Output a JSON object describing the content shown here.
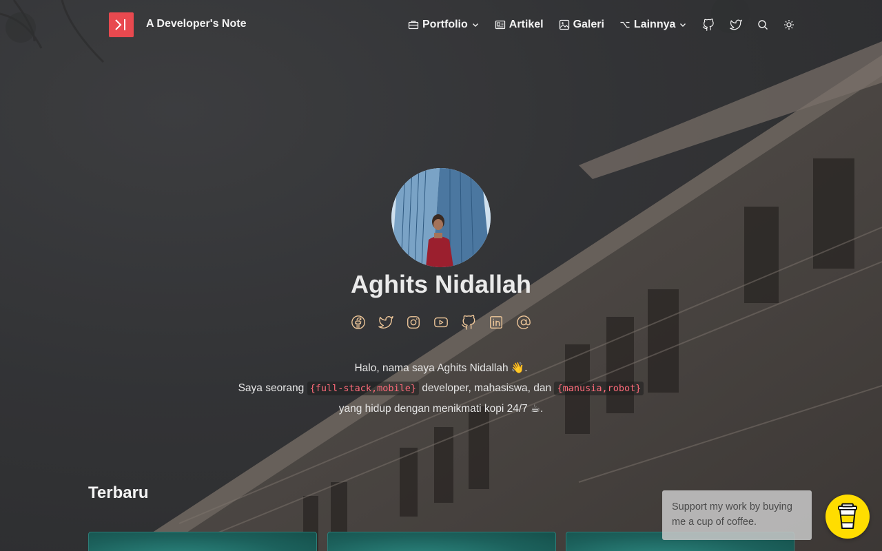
{
  "header": {
    "site_title": "A Developer's Note",
    "nav": [
      {
        "label": "Portfolio",
        "icon": "briefcase-icon",
        "dropdown": true
      },
      {
        "label": "Artikel",
        "icon": "newspaper-icon",
        "dropdown": false
      },
      {
        "label": "Galeri",
        "icon": "image-icon",
        "dropdown": false
      },
      {
        "label": "Lainnya",
        "icon": "option-key-icon",
        "dropdown": true
      }
    ],
    "icon_buttons": [
      "github-icon",
      "twitter-icon",
      "search-icon",
      "sun-icon"
    ]
  },
  "hero": {
    "name": "Aghits Nidallah",
    "socials": [
      "facebook-icon",
      "twitter-icon",
      "instagram-icon",
      "youtube-icon",
      "github-icon",
      "linkedin-icon",
      "at-sign-icon"
    ],
    "bio": {
      "line1": "Halo, nama saya Aghits Nidallah 👋.",
      "line2_a": "Saya seorang",
      "line2_code1": "{full-stack,mobile}",
      "line2_b": "developer, mahasiswa, dan",
      "line2_code2": "{manusia,robot}",
      "line3": "yang hidup dengan menikmati kopi 24/7 ☕."
    }
  },
  "latest": {
    "title": "Terbaru"
  },
  "support": {
    "text": "Support my work by buying me a cup of coffee."
  },
  "colors": {
    "accent": "#e8494f",
    "code": "#ff6b7a",
    "coffee_button": "#ffdd00",
    "social_icon": "#f0c89a"
  }
}
